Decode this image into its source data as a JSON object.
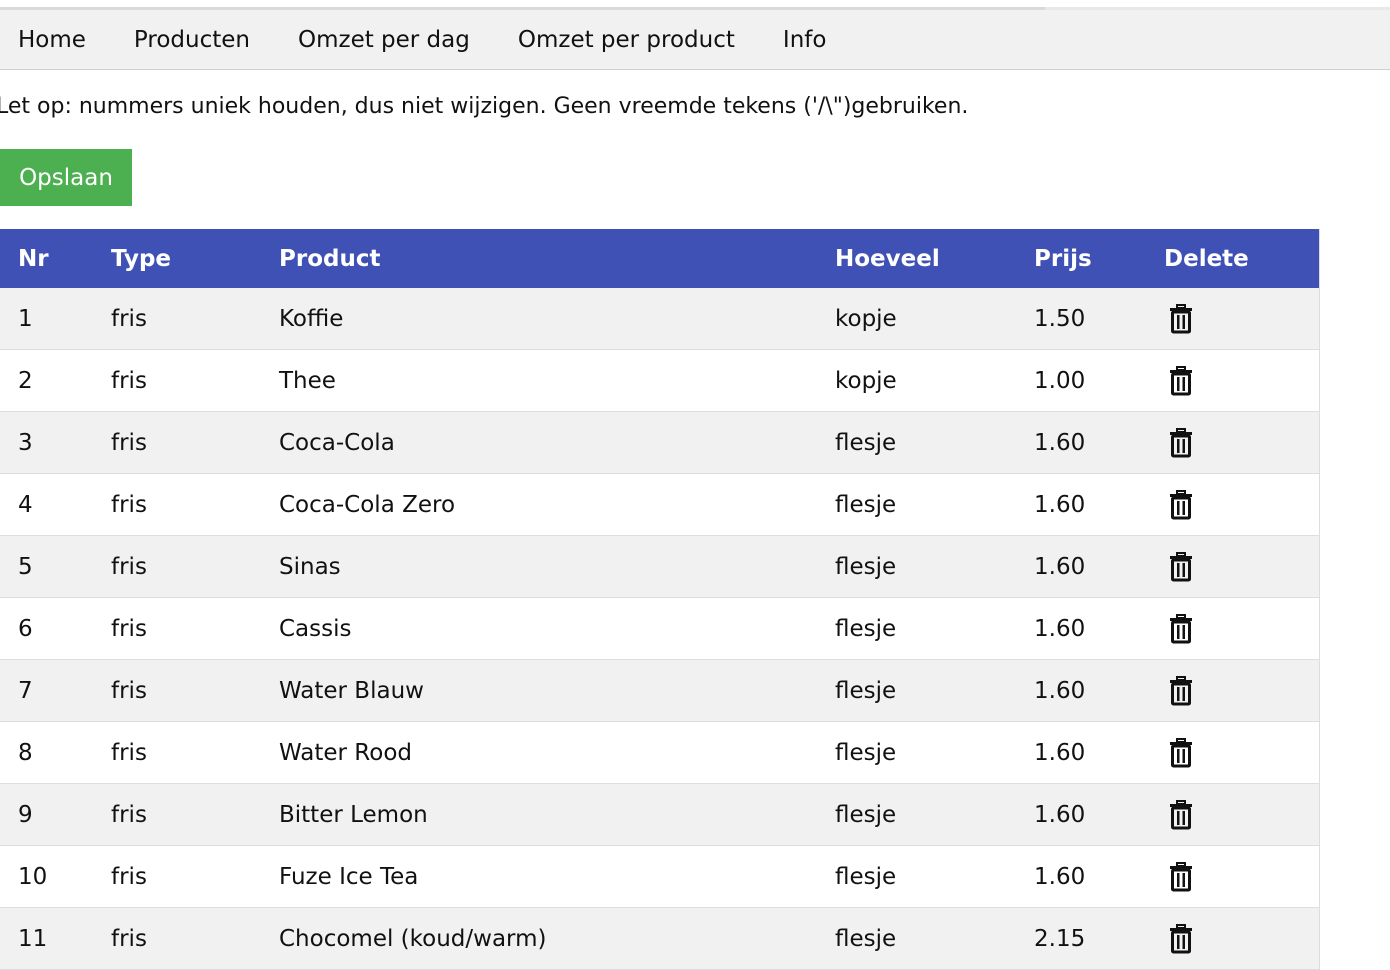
{
  "nav": {
    "items": [
      "Home",
      "Producten",
      "Omzet per dag",
      "Omzet per product",
      "Info"
    ]
  },
  "notice": "Let op: nummers uniek houden, dus niet wijzigen. Geen vreemde tekens ('/\\\")gebruiken.",
  "save_label": "Opslaan",
  "table": {
    "headers": [
      "Nr",
      "Type",
      "Product",
      "Hoeveel",
      "Prijs",
      "Delete"
    ],
    "rows": [
      {
        "nr": "1",
        "type": "fris",
        "product": "Koffie",
        "hoeveel": "kopje",
        "prijs": "1.50"
      },
      {
        "nr": "2",
        "type": "fris",
        "product": "Thee",
        "hoeveel": "kopje",
        "prijs": "1.00"
      },
      {
        "nr": "3",
        "type": "fris",
        "product": "Coca-Cola",
        "hoeveel": "flesje",
        "prijs": "1.60"
      },
      {
        "nr": "4",
        "type": "fris",
        "product": "Coca-Cola Zero",
        "hoeveel": "flesje",
        "prijs": "1.60"
      },
      {
        "nr": "5",
        "type": "fris",
        "product": "Sinas",
        "hoeveel": "flesje",
        "prijs": "1.60"
      },
      {
        "nr": "6",
        "type": "fris",
        "product": "Cassis",
        "hoeveel": "flesje",
        "prijs": "1.60"
      },
      {
        "nr": "7",
        "type": "fris",
        "product": "Water Blauw",
        "hoeveel": "flesje",
        "prijs": "1.60"
      },
      {
        "nr": "8",
        "type": "fris",
        "product": "Water Rood",
        "hoeveel": "flesje",
        "prijs": "1.60"
      },
      {
        "nr": "9",
        "type": "fris",
        "product": "Bitter Lemon",
        "hoeveel": "flesje",
        "prijs": "1.60"
      },
      {
        "nr": "10",
        "type": "fris",
        "product": "Fuze Ice Tea",
        "hoeveel": "flesje",
        "prijs": "1.60"
      },
      {
        "nr": "11",
        "type": "fris",
        "product": "Chocomel (koud/warm)",
        "hoeveel": "flesje",
        "prijs": "2.15"
      }
    ],
    "delete_icon": "trash-icon"
  },
  "colors": {
    "header_bg": "#3f51b5",
    "save_bg": "#4caf50",
    "nav_bg": "#f1f1f1"
  }
}
